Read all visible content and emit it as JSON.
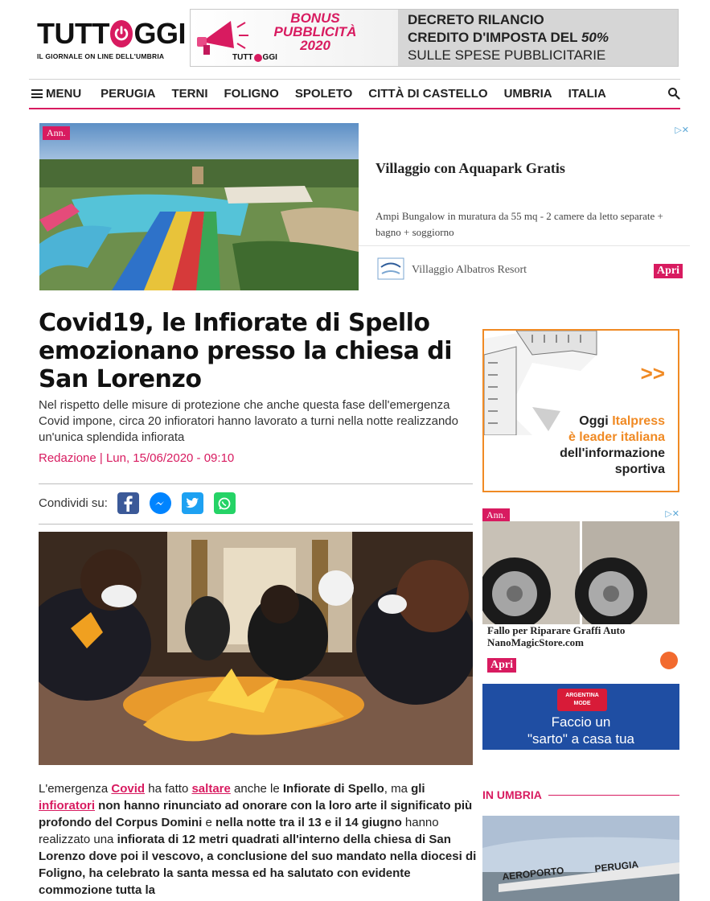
{
  "header": {
    "logo_pre": "TUTT",
    "logo_post": "GGI",
    "logo_tagline": "IL GIORNALE ON LINE DELL'UMBRIA",
    "banner": {
      "bonus_line1": "BONUS",
      "bonus_line2": "PUBBLICITÀ",
      "bonus_line3": "2020",
      "mini_pre": "TUTT",
      "mini_post": "GGI",
      "line1": "DECRETO RILANCIO",
      "line2_pre": "CREDITO D'IMPOSTA DEL ",
      "line2_pct": "50%",
      "line3": "SULLE SPESE PUBBLICITARIE"
    }
  },
  "nav": {
    "menu_label": "MENU",
    "items": [
      "PERUGIA",
      "TERNI",
      "FOLIGNO",
      "SPOLETO",
      "CITTÀ DI CASTELLO",
      "UMBRIA",
      "ITALIA"
    ]
  },
  "ad_top": {
    "badge": "Ann.",
    "title": "Villaggio con Aquapark Gratis",
    "description": "Ampi Bungalow in muratura da 55 mq - 2 camere da letto separate + bagno + soggiorno",
    "brand": "Villaggio Albatros Resort",
    "cta": "Apri"
  },
  "article": {
    "headline": "Covid19, le Infiorate di Spello emozionano presso la chiesa di San Lorenzo",
    "subhead": "Nel rispetto delle misure di protezione che anche questa fase dell'emergenza Covid impone, circa 20 infioratori hanno lavorato a turni nella notte realizzando un'unica splendida infiorata",
    "byline": "Redazione | Lun, 15/06/2020 - 09:10",
    "share_label": "Condividi su:",
    "body": {
      "p1": "L'emergenza ",
      "link_covid": "Covid",
      "p2": " ha fatto ",
      "link_saltare": "saltare",
      "p3": " anche le ",
      "b_infiorate": "Infiorate di Spello",
      "p4": ", ma ",
      "b_gli": "gli",
      "link_infioratori": "infioratori",
      "b_rest1": " non hanno rinunciato ad onorare con la loro arte il significato più profondo del Corpus Domini",
      "p5": " e ",
      "b_notte": "nella notte tra il 13 e il 14 giugno",
      "p6": " hanno realizzato una ",
      "b_rest2": "infiorata di 12 metri quadrati all'interno della chiesa di San Lorenzo dove poi il vescovo, a conclusione del suo mandato nella diocesi di Foligno, ha celebrato la santa messa ed ha salutato con evidente commozione tutta la"
    }
  },
  "sidebar": {
    "ad_italpress": {
      "arrows": ">>",
      "line1_pre": "Oggi ",
      "line1_brand": "Italpress",
      "line2": "è leader italiana",
      "line3": "dell'informazione",
      "line4": "sportiva"
    },
    "ad_nano": {
      "badge": "Ann.",
      "title": "Fallo per Riparare Graffi Auto",
      "domain": "NanoMagicStore.com",
      "cta": "Apri"
    },
    "ad_argentina": {
      "brand": "ARGENTINA",
      "brand_sub": "MODE",
      "line1": "Faccio un",
      "line2": "\"sarto\" a casa tua"
    },
    "section_title": "IN UMBRIA",
    "photo_sign_left": "AEROPORTO",
    "photo_sign_right": "PERUGIA"
  },
  "colors": {
    "accent": "#d81b60",
    "italpress_orange": "#f08a24",
    "argentina_blue": "#1f4ea3"
  }
}
